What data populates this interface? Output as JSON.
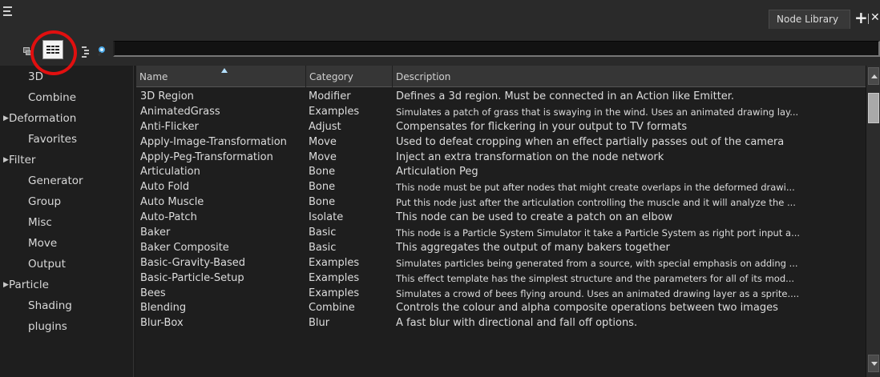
{
  "window": {
    "tab_label": "Node Library",
    "add_tab_glyph": "+",
    "close_glyph": "✕"
  },
  "toolbar": {
    "icons": [
      "tree-view-icon",
      "list-view-icon",
      "hierarchy-icon",
      "search-icon"
    ],
    "search_value": "",
    "highlight_color": "#e10f0f"
  },
  "sidebar": {
    "items": [
      {
        "label": "3D",
        "expandable": false
      },
      {
        "label": "Combine",
        "expandable": false
      },
      {
        "label": "Deformation",
        "expandable": true
      },
      {
        "label": "Favorites",
        "expandable": false
      },
      {
        "label": "Filter",
        "expandable": true
      },
      {
        "label": "Generator",
        "expandable": false
      },
      {
        "label": "Group",
        "expandable": false
      },
      {
        "label": "Misc",
        "expandable": false
      },
      {
        "label": "Move",
        "expandable": false
      },
      {
        "label": "Output",
        "expandable": false
      },
      {
        "label": "Particle",
        "expandable": true
      },
      {
        "label": "Shading",
        "expandable": false
      },
      {
        "label": "plugins",
        "expandable": false
      }
    ]
  },
  "table": {
    "columns": [
      "Name",
      "Category",
      "Description"
    ],
    "rows": [
      {
        "name": "3D Region",
        "category": "Modifier",
        "description": "Defines a 3d region. Must be connected in an Action like Emitter."
      },
      {
        "name": "AnimatedGrass",
        "category": "Examples",
        "description": "Simulates a patch of grass that is swaying in the wind. Uses an animated drawing lay..."
      },
      {
        "name": "Anti-Flicker",
        "category": "Adjust",
        "description": "Compensates for flickering in your output to TV formats"
      },
      {
        "name": "Apply-Image-Transformation",
        "category": "Move",
        "description": "Used to defeat cropping when an effect partially passes out of the camera"
      },
      {
        "name": "Apply-Peg-Transformation",
        "category": "Move",
        "description": "Inject an extra transformation on the node network"
      },
      {
        "name": "Articulation",
        "category": "Bone",
        "description": "Articulation Peg"
      },
      {
        "name": "Auto Fold",
        "category": "Bone",
        "description": "This node must be put after nodes that might create overlaps in the deformed drawi..."
      },
      {
        "name": "Auto Muscle",
        "category": "Bone",
        "description": "Put this node just after the articulation controlling the muscle and it will analyze the ..."
      },
      {
        "name": "Auto-Patch",
        "category": "Isolate",
        "description": "This node can be used to create a patch on an elbow"
      },
      {
        "name": "Baker",
        "category": "Basic",
        "description": "This node is a Particle System Simulator it take a Particle System as right port input a..."
      },
      {
        "name": "Baker Composite",
        "category": "Basic",
        "description": "This aggregates the output of many bakers together"
      },
      {
        "name": "Basic-Gravity-Based",
        "category": "Examples",
        "description": "Simulates particles being generated from a source, with special emphasis on adding ..."
      },
      {
        "name": "Basic-Particle-Setup",
        "category": "Examples",
        "description": "This effect template has the simplest structure and the parameters for all of its mod..."
      },
      {
        "name": "Bees",
        "category": "Examples",
        "description": "Simulates a crowd of bees flying around. Uses an animated drawing layer as a sprite...."
      },
      {
        "name": "Blending",
        "category": "Combine",
        "description": "Controls the colour and alpha composite operations between two images"
      },
      {
        "name": "Blur-Box",
        "category": "Blur",
        "description": "A fast blur with directional and fall off options."
      }
    ]
  }
}
